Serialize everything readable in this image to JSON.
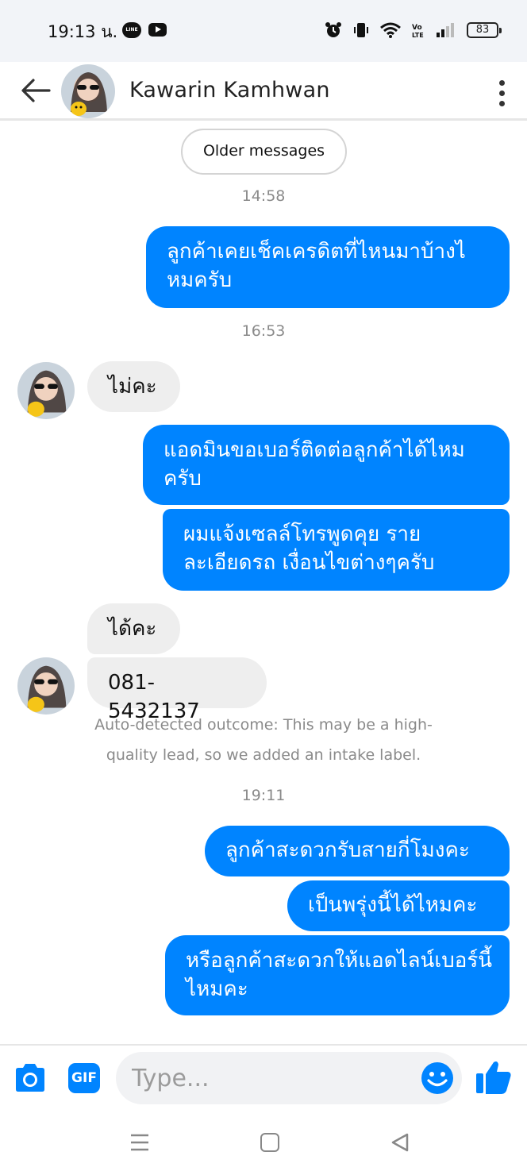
{
  "status_bar": {
    "time": "19:13 น.",
    "line_icon_text": "LINE",
    "battery": "83",
    "icons": [
      "line-icon",
      "youtube-icon",
      "alarm-icon",
      "vibrate-icon",
      "wifi-icon",
      "volte-icon",
      "signal-icon",
      "battery-icon"
    ]
  },
  "header": {
    "contact_name": "Kawarin Kamhwan",
    "icons": [
      "back-arrow-icon",
      "more-vertical-icon"
    ]
  },
  "chat": {
    "older_messages_label": "Older messages",
    "time_1": "14:58",
    "msg_out_1": "ลูกค้าเคยเช็คเครดิตที่ไหนมาบ้างไ หมครับ",
    "time_2": "16:53",
    "msg_in_1": "ไม่คะ",
    "msg_out_2": "แอดมินขอเบอร์ติดต่อลูกค้าได้ไหม ครับ",
    "msg_out_3": "ผมแจ้งเซลล์โทรพูดคุย รายละเอียดรถ เงื่อนไขต่างๆครับ",
    "msg_in_2": "ได้คะ",
    "msg_in_3": "081-5432137",
    "note_line_1": "Auto-detected outcome: This may be a high-",
    "note_line_2": "quality lead, so we added an intake label.",
    "time_3": "19:11",
    "msg_out_4": "ลูกค้าสะดวกรับสายกี่โมงคะ",
    "msg_out_5": "เป็นพรุ่งนี้ได้ไหมคะ",
    "msg_out_6": "หรือลูกค้าสะดวกให้แอดไลน์เบอร์นี้ไหมคะ"
  },
  "composer": {
    "placeholder": "Type...",
    "gif_label": "GIF",
    "icons": [
      "camera-icon",
      "emoji-icon",
      "thumbs-up-icon"
    ]
  },
  "nav_bar": {
    "icons": [
      "recent-apps-icon",
      "home-icon",
      "back-icon"
    ]
  },
  "colors": {
    "accent": "#0084ff",
    "incoming_bubble": "#eeeeee",
    "status_bar_bg": "#f2f4f8",
    "muted_text": "#8a8a8a"
  }
}
